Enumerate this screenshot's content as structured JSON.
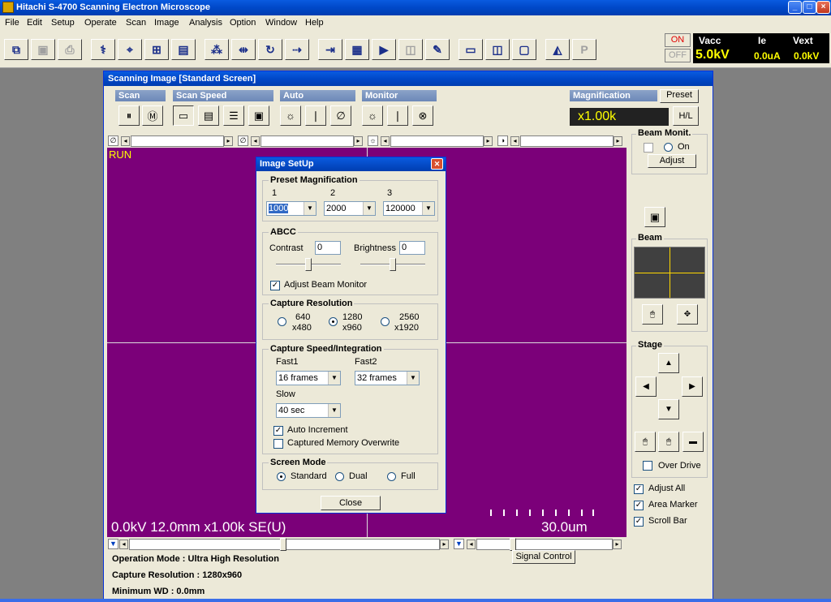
{
  "app": {
    "title": "Hitachi S-4700 Scanning Electron Microscope"
  },
  "menu": [
    "File",
    "Edit",
    "Setup",
    "Operate",
    "Scan",
    "Image",
    "Analysis",
    "Option",
    "Window",
    "Help"
  ],
  "power": {
    "on": "ON",
    "off": "OFF"
  },
  "voltages": {
    "vacc_label": "Vacc",
    "vacc_value": "5.0kV",
    "ie_label": "Ie",
    "ie_value": "0.0uA",
    "vext_label": "Vext",
    "vext_value": "0.0kV"
  },
  "scan_window": {
    "title": "Scanning Image [Standard Screen]",
    "groups": {
      "scan": "Scan",
      "scan_speed": "Scan Speed",
      "auto": "Auto",
      "monitor": "Monitor",
      "magnification": "Magnification"
    },
    "preset_label": "Preset",
    "magnification_value": "x1.00k",
    "hl_label": "H/L",
    "image": {
      "run_label": "RUN",
      "info": "0.0kV 12.0mm x1.00k SE(U)",
      "scale": "30.0um"
    },
    "status": {
      "operation_mode": "Operation Mode : Ultra High Resolution",
      "capture_resolution": "Capture Resolution : 1280x960",
      "minimum_wd": "Minimum WD : 0.0mm"
    },
    "signal_control": "Signal Control",
    "right_panel": {
      "beam_monitor": "Beam Monit.",
      "on_label": "On",
      "adjust": "Adjust",
      "beam": "Beam",
      "stage": "Stage",
      "over_drive": "Over Drive",
      "adjust_all": "Adjust All",
      "area_marker": "Area Marker",
      "scroll_bar": "Scroll Bar"
    }
  },
  "dialog": {
    "title": "Image SetUp",
    "preset_mag": {
      "label": "Preset Magnification",
      "col1": "1",
      "col2": "2",
      "col3": "3",
      "val1": "1000",
      "val2": "2000",
      "val3": "120000"
    },
    "abcc": {
      "label": "ABCC",
      "contrast": "Contrast",
      "contrast_value": "0",
      "brightness": "Brightness",
      "brightness_value": "0",
      "adjust_beam_monitor": "Adjust Beam Monitor"
    },
    "capture_resolution": {
      "label": "Capture Resolution",
      "r1a": "640",
      "r1b": "x480",
      "r2a": "1280",
      "r2b": "x960",
      "r3a": "2560",
      "r3b": "x1920"
    },
    "capture_speed": {
      "label": "Capture Speed/Integration",
      "fast1": "Fast1",
      "fast1_value": "16 frames",
      "fast2": "Fast2",
      "fast2_value": "32 frames",
      "slow": "Slow",
      "slow_value": "40 sec",
      "auto_increment": "Auto Increment",
      "captured_overwrite": "Captured Memory Overwrite"
    },
    "screen_mode": {
      "label": "Screen Mode",
      "standard": "Standard",
      "dual": "Dual",
      "full": "Full"
    },
    "close": "Close"
  }
}
